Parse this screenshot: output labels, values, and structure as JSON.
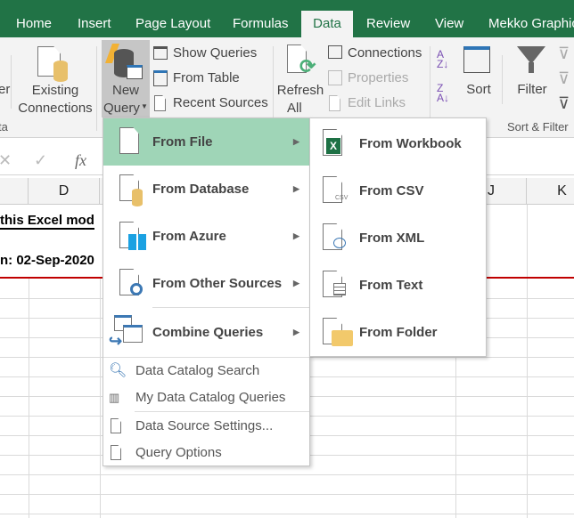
{
  "tabs": [
    "Home",
    "Insert",
    "Page Layout",
    "Formulas",
    "Data",
    "Review",
    "View",
    "Mekko Graphic"
  ],
  "active_tab": "Data",
  "ribbon": {
    "partial_left": "er",
    "existing_connections": [
      "Existing",
      "Connections"
    ],
    "new_query": [
      "New",
      "Query"
    ],
    "show_queries": "Show Queries",
    "from_table": "From Table",
    "recent_sources": "Recent Sources",
    "refresh_all": [
      "Refresh",
      "All"
    ],
    "connections": "Connections",
    "properties": "Properties",
    "edit_links": "Edit Links",
    "sort": "Sort",
    "filter": "Filter",
    "group_partial": "ta",
    "group_sort_filter": "Sort & Filter"
  },
  "formula_bar": {
    "fx": "fx"
  },
  "columns": [
    "D",
    "J",
    "K"
  ],
  "cells": {
    "row1": "this Excel mod",
    "row2": "n: 02-Sep-2020"
  },
  "menu": {
    "items": [
      "From File",
      "From Database",
      "From Azure",
      "From Other Sources",
      "Combine Queries"
    ],
    "simple_items": [
      "Data Catalog Search",
      "My Data Catalog Queries",
      "Data Source Settings...",
      "Query Options"
    ],
    "highlighted": "From File"
  },
  "submenu": {
    "items": [
      "From Workbook",
      "From CSV",
      "From XML",
      "From Text",
      "From Folder"
    ]
  },
  "colors": {
    "excel_green": "#217346",
    "highlight": "#9fd5b7",
    "red_line": "#c00000"
  }
}
